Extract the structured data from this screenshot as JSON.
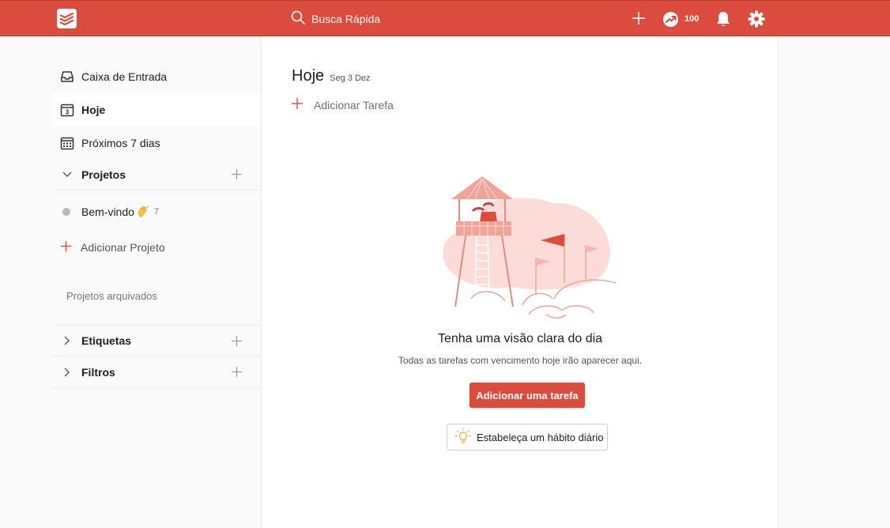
{
  "topbar": {
    "logo_icon": "todoist-logo-icon",
    "search_placeholder": "Busca Rápida",
    "karma_value": "100",
    "accent": "#db4c3f"
  },
  "sidebar": {
    "inbox_label": "Caixa de Entrada",
    "today_label": "Hoje",
    "today_day": "3",
    "upcoming_label": "Próximos 7 dias",
    "projects_label": "Projetos",
    "projects": [
      {
        "name": "Bem-vindo",
        "emoji": "waving-hand",
        "count": "7"
      }
    ],
    "add_project_label": "Adicionar Projeto",
    "archived_label": "Projetos arquivados",
    "labels_label": "Etiquetas",
    "filters_label": "Filtros"
  },
  "main": {
    "title": "Hoje",
    "date": "Seg 3 Dez",
    "add_task_label": "Adicionar Tarefa",
    "empty_title": "Tenha uma visão clara do dia",
    "empty_subtitle": "Todas as tarefas com vencimento hoje irão aparecer aqui.",
    "primary_button": "Adicionar uma tarefa",
    "habit_button": "Estabeleça um hábito diário"
  }
}
